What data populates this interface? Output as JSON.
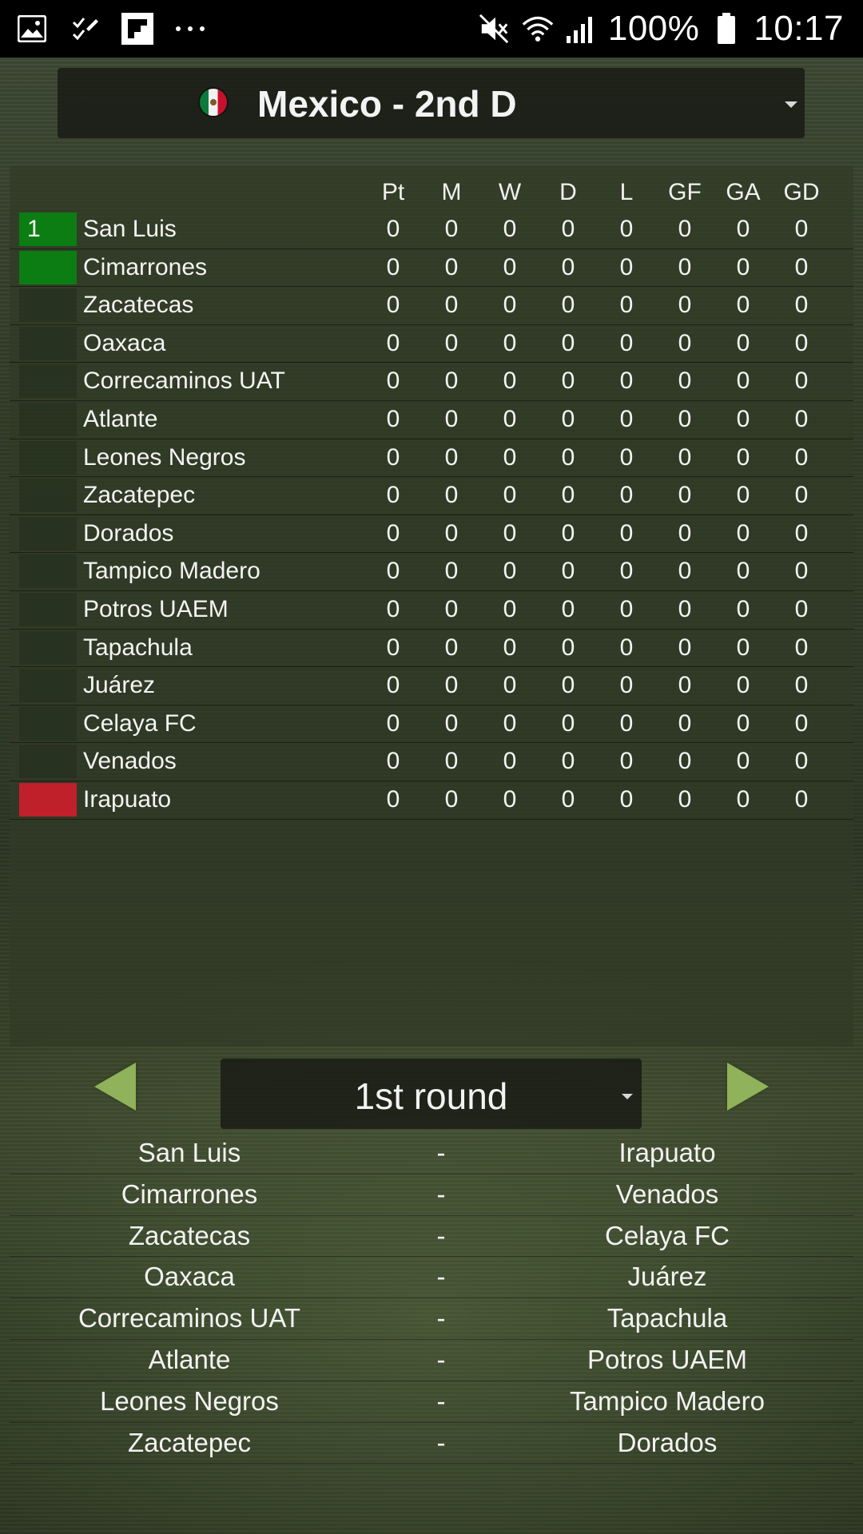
{
  "status_bar": {
    "battery": "100%",
    "time": "10:17"
  },
  "league": {
    "name": "Mexico - 2nd D"
  },
  "table": {
    "columns": [
      "Pt",
      "M",
      "W",
      "D",
      "L",
      "GF",
      "GA",
      "GD"
    ],
    "rows": [
      {
        "pos": "1",
        "zone": "promotion",
        "team": "San Luis",
        "stats": [
          "0",
          "0",
          "0",
          "0",
          "0",
          "0",
          "0",
          "0"
        ]
      },
      {
        "pos": "",
        "zone": "promotion",
        "team": "Cimarrones",
        "stats": [
          "0",
          "0",
          "0",
          "0",
          "0",
          "0",
          "0",
          "0"
        ]
      },
      {
        "pos": "",
        "zone": "",
        "team": "Zacatecas",
        "stats": [
          "0",
          "0",
          "0",
          "0",
          "0",
          "0",
          "0",
          "0"
        ]
      },
      {
        "pos": "",
        "zone": "",
        "team": "Oaxaca",
        "stats": [
          "0",
          "0",
          "0",
          "0",
          "0",
          "0",
          "0",
          "0"
        ]
      },
      {
        "pos": "",
        "zone": "",
        "team": "Correcaminos UAT",
        "stats": [
          "0",
          "0",
          "0",
          "0",
          "0",
          "0",
          "0",
          "0"
        ]
      },
      {
        "pos": "",
        "zone": "",
        "team": "Atlante",
        "stats": [
          "0",
          "0",
          "0",
          "0",
          "0",
          "0",
          "0",
          "0"
        ]
      },
      {
        "pos": "",
        "zone": "",
        "team": "Leones Negros",
        "stats": [
          "0",
          "0",
          "0",
          "0",
          "0",
          "0",
          "0",
          "0"
        ]
      },
      {
        "pos": "",
        "zone": "",
        "team": "Zacatepec",
        "stats": [
          "0",
          "0",
          "0",
          "0",
          "0",
          "0",
          "0",
          "0"
        ]
      },
      {
        "pos": "",
        "zone": "",
        "team": "Dorados",
        "stats": [
          "0",
          "0",
          "0",
          "0",
          "0",
          "0",
          "0",
          "0"
        ]
      },
      {
        "pos": "",
        "zone": "",
        "team": "Tampico Madero",
        "stats": [
          "0",
          "0",
          "0",
          "0",
          "0",
          "0",
          "0",
          "0"
        ]
      },
      {
        "pos": "",
        "zone": "",
        "team": "Potros UAEM",
        "stats": [
          "0",
          "0",
          "0",
          "0",
          "0",
          "0",
          "0",
          "0"
        ]
      },
      {
        "pos": "",
        "zone": "",
        "team": "Tapachula",
        "stats": [
          "0",
          "0",
          "0",
          "0",
          "0",
          "0",
          "0",
          "0"
        ]
      },
      {
        "pos": "",
        "zone": "",
        "team": "Juárez",
        "stats": [
          "0",
          "0",
          "0",
          "0",
          "0",
          "0",
          "0",
          "0"
        ]
      },
      {
        "pos": "",
        "zone": "",
        "team": "Celaya FC",
        "stats": [
          "0",
          "0",
          "0",
          "0",
          "0",
          "0",
          "0",
          "0"
        ]
      },
      {
        "pos": "",
        "zone": "",
        "team": "Venados",
        "stats": [
          "0",
          "0",
          "0",
          "0",
          "0",
          "0",
          "0",
          "0"
        ]
      },
      {
        "pos": "",
        "zone": "relegation",
        "team": "Irapuato",
        "stats": [
          "0",
          "0",
          "0",
          "0",
          "0",
          "0",
          "0",
          "0"
        ]
      }
    ]
  },
  "round": {
    "label": "1st round"
  },
  "fixtures": [
    {
      "home": "San Luis",
      "sep": "-",
      "away": "Irapuato"
    },
    {
      "home": "Cimarrones",
      "sep": "-",
      "away": "Venados"
    },
    {
      "home": "Zacatecas",
      "sep": "-",
      "away": "Celaya FC"
    },
    {
      "home": "Oaxaca",
      "sep": "-",
      "away": "Juárez"
    },
    {
      "home": "Correcaminos UAT",
      "sep": "-",
      "away": "Tapachula"
    },
    {
      "home": "Atlante",
      "sep": "-",
      "away": "Potros UAEM"
    },
    {
      "home": "Leones Negros",
      "sep": "-",
      "away": "Tampico Madero"
    },
    {
      "home": "Zacatepec",
      "sep": "-",
      "away": "Dorados"
    }
  ],
  "colors": {
    "promotion": "#0b7d12",
    "relegation": "#c0202a",
    "arrow": "#8fb25a"
  }
}
